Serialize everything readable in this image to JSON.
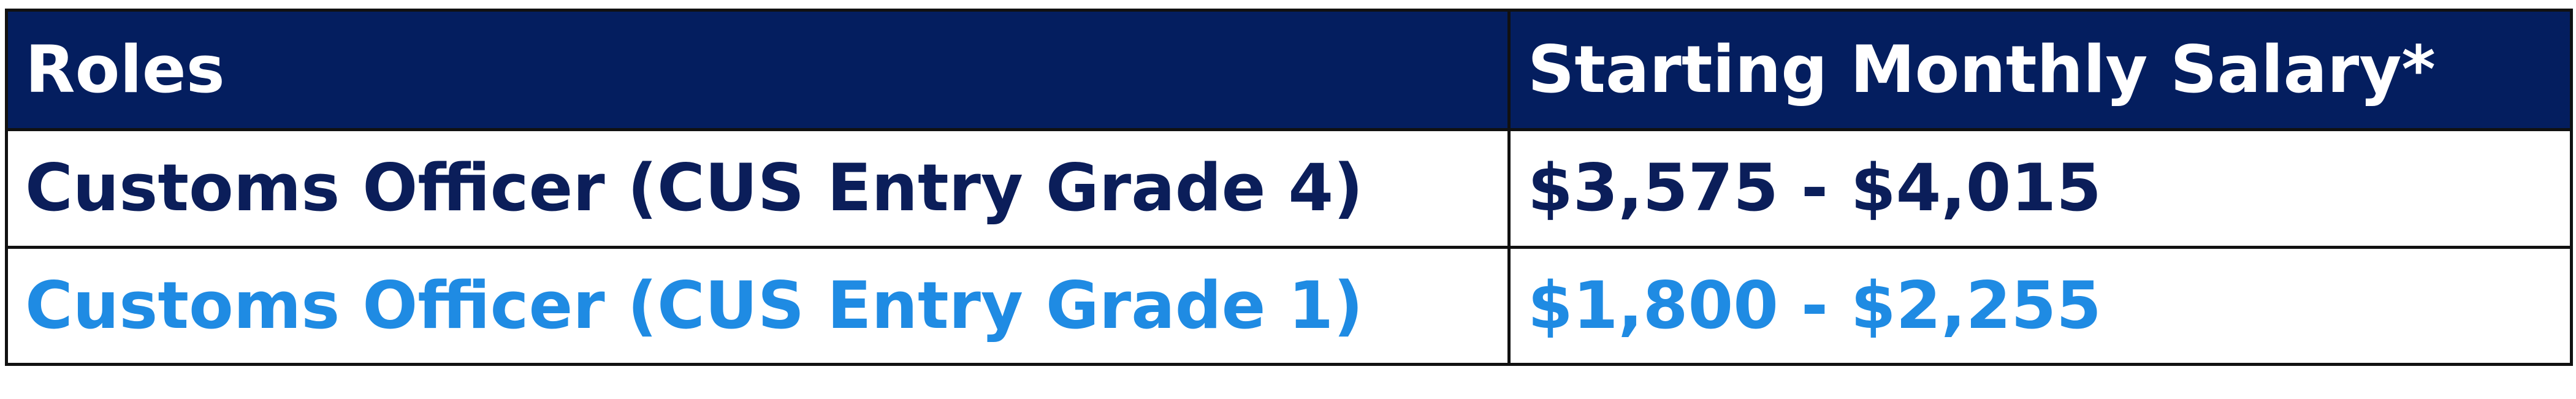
{
  "table": {
    "headers": {
      "role": "Roles",
      "salary": "Starting Monthly Salary*"
    },
    "rows": [
      {
        "role": "Customs Officer (CUS Entry Grade 4)",
        "salary": "$3,575 - $4,015",
        "text_color": "#0b1e5a"
      },
      {
        "role": "Customs Officer (CUS Entry Grade 1)",
        "salary": "$1,800 - $2,255",
        "text_color": "#1f8be3"
      }
    ]
  },
  "colors": {
    "header_background": "#041e5f",
    "header_text": "#ffffff",
    "border": "#111111"
  }
}
